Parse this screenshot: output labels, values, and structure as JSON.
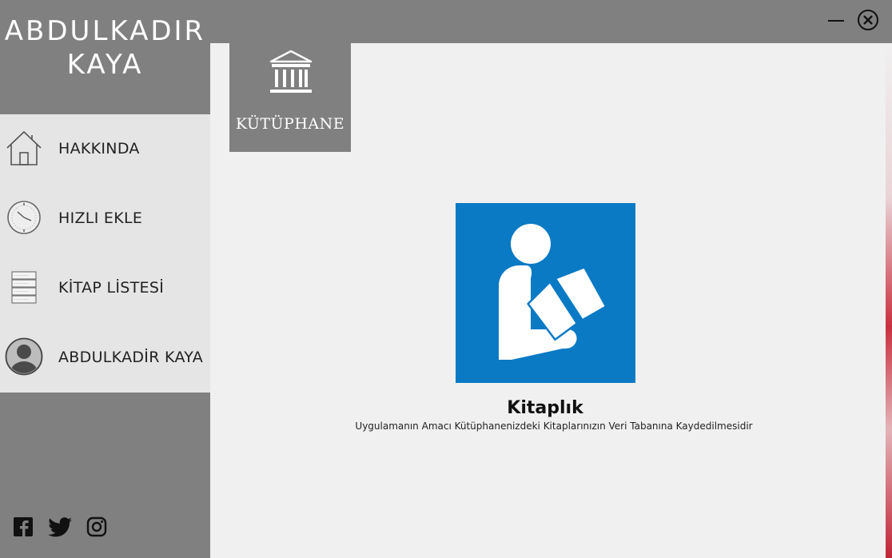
{
  "window": {
    "minimize_label": "minimize",
    "close_label": "close"
  },
  "sidebar": {
    "brand_line1": "ABDULKADIR",
    "brand_line2": "KAYA",
    "items": [
      {
        "label": "HAKKINDA",
        "icon": "home-icon"
      },
      {
        "label": "HIZLI EKLE",
        "icon": "clock-icon"
      },
      {
        "label": "KİTAP LİSTESİ",
        "icon": "book-list-icon"
      },
      {
        "label": "ABDULKADİR KAYA",
        "icon": "user-avatar-icon"
      }
    ],
    "social": [
      "facebook-icon",
      "twitter-icon",
      "instagram-icon"
    ]
  },
  "main": {
    "tile_label": "KÜTÜPHANE",
    "tile_icon": "library-building-icon",
    "logo_icon": "reading-person-icon",
    "logo_color": "#0a7ac4",
    "title": "Kitaplık",
    "description": "Uygulamanın Amacı Kütüphanenizdeki Kitaplarınızın Veri Tabanına Kaydedilmesidir"
  },
  "colors": {
    "sidebar": "#808080",
    "nav_bg": "#e5e5e5",
    "content_bg": "#f0f0f0",
    "accent_blue": "#0a7ac4"
  }
}
